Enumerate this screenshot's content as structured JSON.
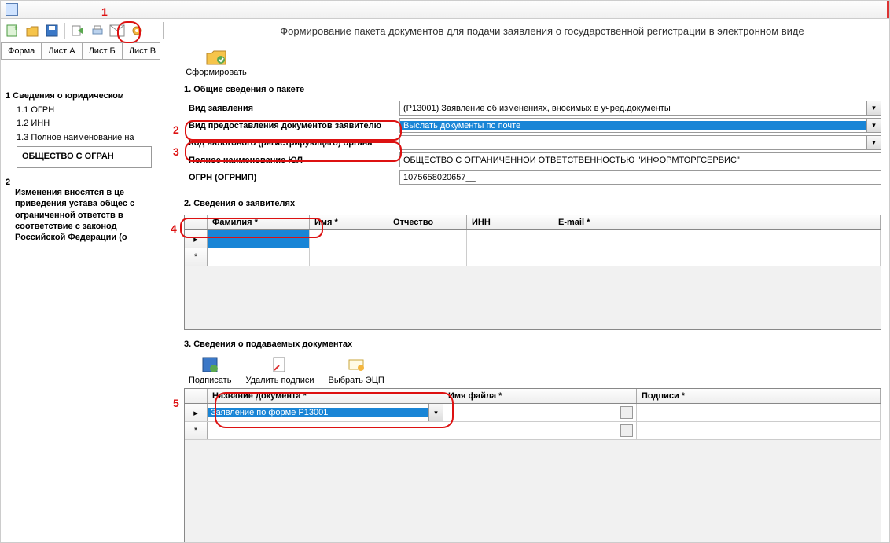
{
  "window_title": "Формирование пакета документов для подачи заявления о государственной регистрации в электронном виде",
  "left_tabs": [
    "Форма",
    "Лист А",
    "Лист Б",
    "Лист В"
  ],
  "tree": {
    "root": "1  Сведения о юридическом",
    "sub": [
      "1.1  ОГРН",
      "1.2  ИНН",
      "1.3  Полное наименование на"
    ],
    "box": "ОБЩЕСТВО С ОГРАН",
    "para_num": "2",
    "para": "Изменения вносятся в це приведения устава общес с ограниченной ответств в соответствие с законод Российской Федерации (о"
  },
  "form_button": "Сформировать",
  "section1": {
    "title": "1. Общие сведения о пакете",
    "rows": {
      "vid_zayav_label": "Вид заявления",
      "vid_zayav_value": "(Р13001) Заявление об изменениях, вносимых в учред.документы",
      "vid_pred_label": "Вид предоставления документов заявителю",
      "vid_pred_value": "Выслать документы по почте",
      "kod_label": "Код налогового (регистрирующего) органа",
      "kod_value": "",
      "name_label": "Полное наименование ЮЛ",
      "name_value": "ОБЩЕСТВО С ОГРАНИЧЕННОЙ ОТВЕТСТВЕННОСТЬЮ \"ИНФОРМТОРГСЕРВИС\"",
      "ogrn_label": "ОГРН (ОГРНИП)",
      "ogrn_value": "1075658020657__"
    }
  },
  "section2": {
    "title": "2. Сведения о заявителях",
    "cols": [
      "Фамилия *",
      "Имя *",
      "Отчество",
      "ИНН",
      "E-mail *"
    ]
  },
  "section3": {
    "title": "3. Сведения о подаваемых документах",
    "toolbar": [
      "Подписать",
      "Удалить подписи",
      "Выбрать ЭЦП"
    ],
    "cols": [
      "Название документа *",
      "Имя файла *",
      "Подписи *"
    ],
    "row1": "Заявление по форме Р13001"
  },
  "marks": [
    "1",
    "2",
    "3",
    "4",
    "5"
  ]
}
